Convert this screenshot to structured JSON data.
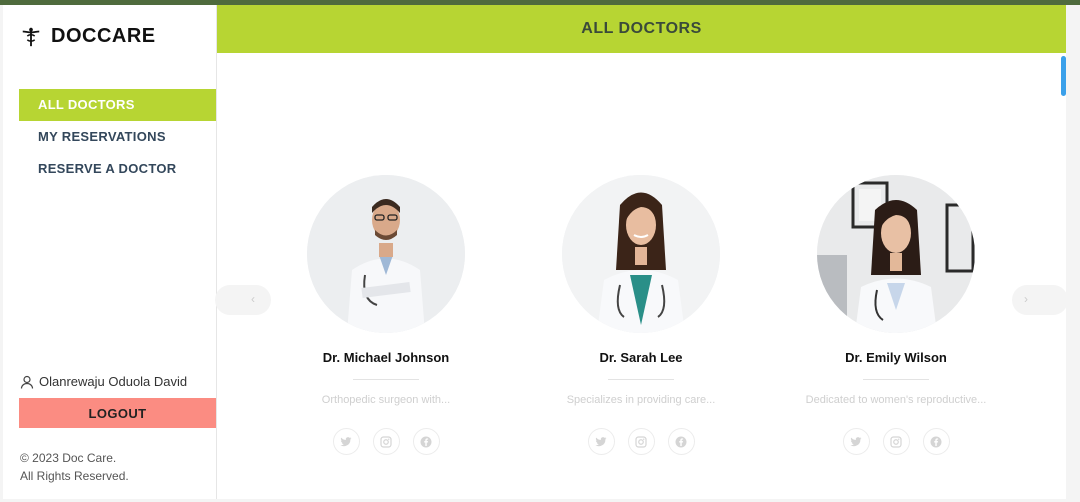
{
  "app": {
    "brand": "DOCCARE"
  },
  "sidebar": {
    "nav": [
      {
        "label": "ALL DOCTORS",
        "active": true
      },
      {
        "label": "MY RESERVATIONS",
        "active": false
      },
      {
        "label": "RESERVE A DOCTOR",
        "active": false
      }
    ],
    "user_name": "Olanrewaju Oduola David",
    "logout_label": "LOGOUT",
    "footer_line1": "© 2023 Doc Care.",
    "footer_line2": "All Rights Reserved."
  },
  "main": {
    "title": "ALL DOCTORS",
    "doctors": [
      {
        "name": "Dr. Michael Johnson",
        "description": "Orthopedic surgeon with...",
        "socials": [
          "twitter-icon",
          "instagram-icon",
          "facebook-icon"
        ]
      },
      {
        "name": "Dr. Sarah Lee",
        "description": "Specializes in providing care...",
        "socials": [
          "twitter-icon",
          "instagram-icon",
          "facebook-icon"
        ]
      },
      {
        "name": "Dr. Emily Wilson",
        "description": "Dedicated to women's reproductive...",
        "socials": [
          "twitter-icon",
          "instagram-icon",
          "facebook-icon"
        ]
      }
    ]
  },
  "colors": {
    "accent": "#b7d533",
    "logout": "#fb8c82",
    "topbar": "#4f6b3d",
    "scroll": "#3aa0ea"
  }
}
